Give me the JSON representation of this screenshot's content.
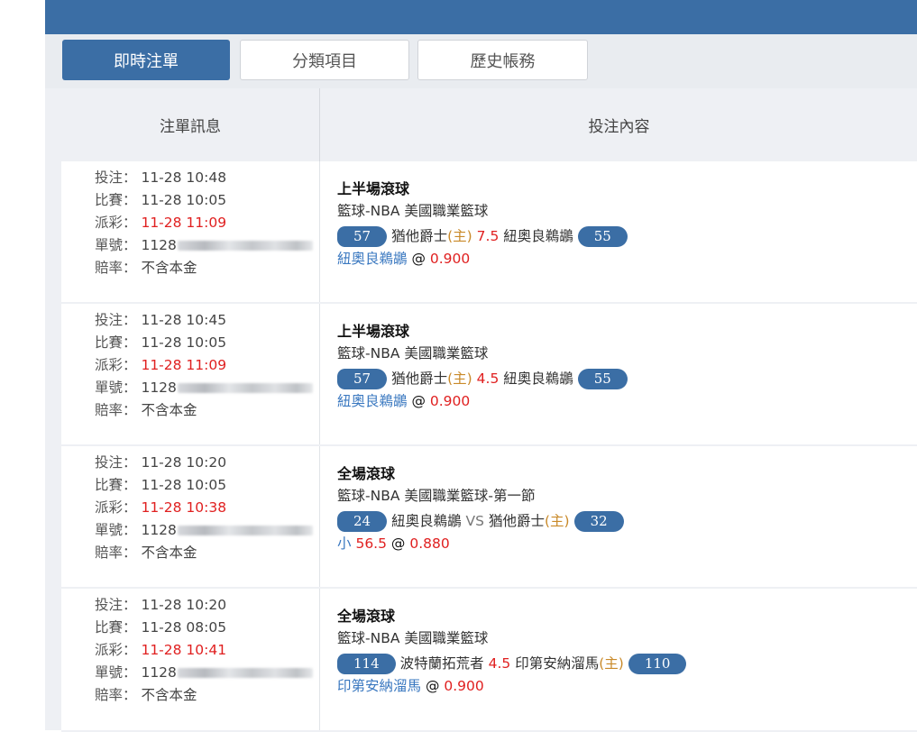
{
  "tabs": [
    {
      "label": "即時注單",
      "active": true
    },
    {
      "label": "分類項目",
      "active": false
    },
    {
      "label": "歷史帳務",
      "active": false
    }
  ],
  "columns": {
    "info": "注單訊息",
    "content": "投注內容"
  },
  "labels": {
    "bet_time": "投注：",
    "match_time": "比賽：",
    "settle_time": "派彩：",
    "ticket": "單號：",
    "odds_type": "賠率："
  },
  "colors": {
    "primary": "#3b6ea5",
    "red": "#e02020",
    "home": "#c98a2a",
    "selection": "#3a78c0"
  },
  "bets": [
    {
      "bet_time": "11-28 10:48",
      "match_time": "11-28 10:05",
      "settle_time": "11-28 11:09",
      "ticket": "1128",
      "odds_type": "不含本金",
      "bet_type": "上半場滾球",
      "league": "籃球-NBA 美國職業籃球",
      "score_left": "57",
      "team_left": "猶他爵士",
      "left_home": "(主)",
      "handicap": "7.5",
      "sep": "",
      "team_right": "紐奧良鵜鶘",
      "right_home": "",
      "score_right": "55",
      "selection": "紐奧良鵜鶘",
      "at": "@",
      "odds": "0.900"
    },
    {
      "bet_time": "11-28 10:45",
      "match_time": "11-28 10:05",
      "settle_time": "11-28 11:09",
      "ticket": "1128",
      "odds_type": "不含本金",
      "bet_type": "上半場滾球",
      "league": "籃球-NBA 美國職業籃球",
      "score_left": "57",
      "team_left": "猶他爵士",
      "left_home": "(主)",
      "handicap": "4.5",
      "sep": "",
      "team_right": "紐奧良鵜鶘",
      "right_home": "",
      "score_right": "55",
      "selection": "紐奧良鵜鶘",
      "at": "@",
      "odds": "0.900"
    },
    {
      "bet_time": "11-28 10:20",
      "match_time": "11-28 10:05",
      "settle_time": "11-28 10:38",
      "ticket": "1128",
      "odds_type": "不含本金",
      "bet_type": "全場滾球",
      "league": "籃球-NBA 美國職業籃球-第一節",
      "score_left": "24",
      "team_left": "紐奧良鵜鶘",
      "left_home": "",
      "handicap": "",
      "sep": "VS",
      "team_right": "猶他爵士",
      "right_home": "(主)",
      "score_right": "32",
      "selection": "小",
      "selection_value": "56.5",
      "at": "@",
      "odds": "0.880"
    },
    {
      "bet_time": "11-28 10:20",
      "match_time": "11-28 08:05",
      "settle_time": "11-28 10:41",
      "ticket": "1128",
      "odds_type": "不含本金",
      "bet_type": "全場滾球",
      "league": "籃球-NBA 美國職業籃球",
      "score_left": "114",
      "team_left": "波特蘭拓荒者",
      "left_home": "",
      "handicap": "4.5",
      "sep": "",
      "team_right": "印第安納溜馬",
      "right_home": "(主)",
      "score_right": "110",
      "selection": "印第安納溜馬",
      "at": "@",
      "odds": "0.900"
    }
  ]
}
